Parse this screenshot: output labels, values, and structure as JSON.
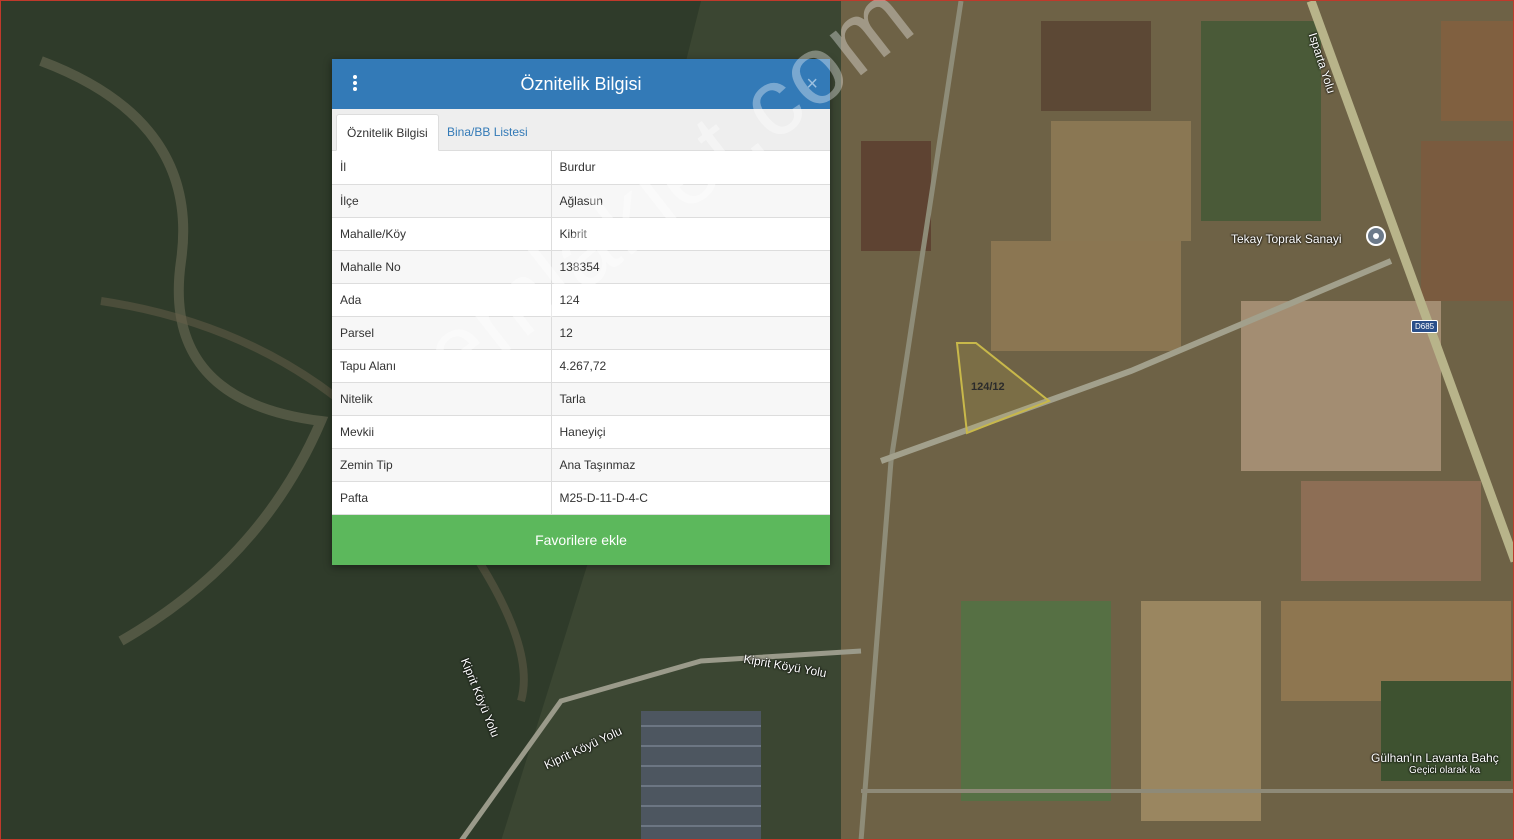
{
  "map": {
    "labels": {
      "isparta_road": "Isparta Yolu",
      "tekay": "Tekay Toprak Sanayi",
      "road_badge": "D685",
      "kiprit_road_1": "Kiprit Köyü Yolu",
      "kiprit_road_2": "Kiprit Köyü Yolu",
      "kiprit_road_3": "Kiprit Köyü Yolu",
      "gulhan": "Gülhan'ın Lavanta Bahç",
      "gulhan_sub": "Geçici olarak ka",
      "parcel": "124/12"
    },
    "watermark": "emlakjet.com"
  },
  "dialog": {
    "title": "Öznitelik Bilgisi",
    "close_symbol": "×",
    "tabs": [
      "Öznitelik Bilgisi",
      "Bina/BB Listesi"
    ],
    "rows": [
      {
        "key": "İl",
        "value": "Burdur"
      },
      {
        "key": "İlçe",
        "value": "Ağlasun"
      },
      {
        "key": "Mahalle/Köy",
        "value": "Kibrit"
      },
      {
        "key": "Mahalle No",
        "value": "138354"
      },
      {
        "key": "Ada",
        "value": "124"
      },
      {
        "key": "Parsel",
        "value": "12"
      },
      {
        "key": "Tapu Alanı",
        "value": "4.267,72"
      },
      {
        "key": "Nitelik",
        "value": "Tarla"
      },
      {
        "key": "Mevkii",
        "value": "Haneyiçi"
      },
      {
        "key": "Zemin Tip",
        "value": "Ana Taşınmaz"
      },
      {
        "key": "Pafta",
        "value": "M25-D-11-D-4-C"
      }
    ],
    "button_label": "Favorilere ekle"
  },
  "colors": {
    "header": "#337ab7",
    "button": "#5cb85c",
    "parcel_outline": "#c8b84a"
  }
}
